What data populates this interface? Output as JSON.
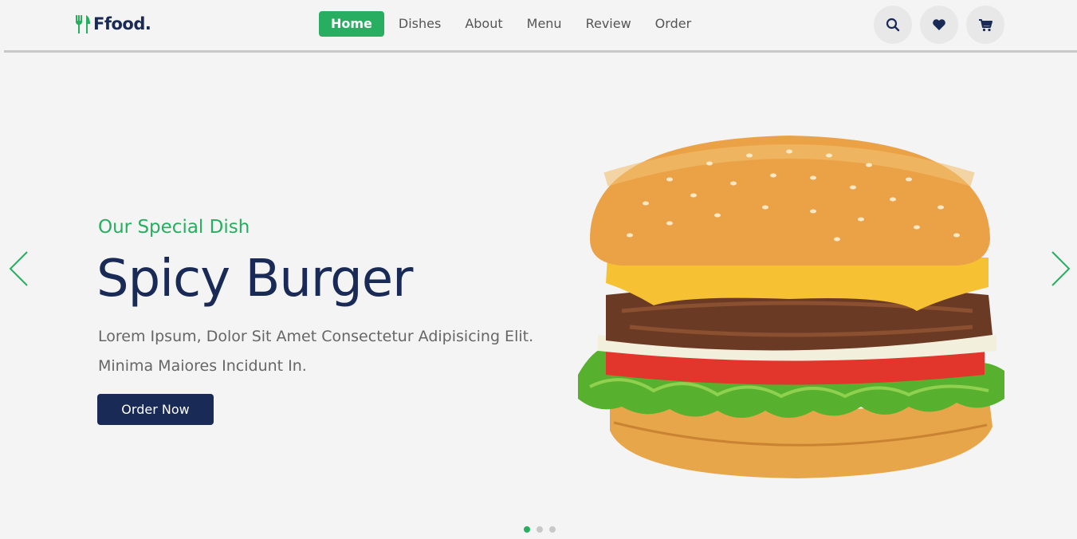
{
  "brand": {
    "name": "Ffood.",
    "accent_color": "#27ae60",
    "primary_color": "#192a56",
    "icon": "utensils-icon"
  },
  "nav": {
    "items": [
      {
        "label": "Home",
        "active": true
      },
      {
        "label": "Dishes",
        "active": false
      },
      {
        "label": "About",
        "active": false
      },
      {
        "label": "Menu",
        "active": false
      },
      {
        "label": "Review",
        "active": false
      },
      {
        "label": "Order",
        "active": false
      }
    ]
  },
  "header_icons": [
    "search-icon",
    "heart-icon",
    "cart-icon"
  ],
  "hero": {
    "subtitle": "Our Special Dish",
    "title": "Spicy Burger",
    "description_line1": "Lorem Ipsum, Dolor Sit Amet Consectetur Adipisicing Elit.",
    "description_line2": "Minima Maiores Incidunt In.",
    "cta_label": "Order Now",
    "image": "burger-image"
  },
  "slider": {
    "slide_count": 3,
    "active_index": 0,
    "prev_icon": "chevron-left-icon",
    "next_icon": "chevron-right-icon"
  }
}
